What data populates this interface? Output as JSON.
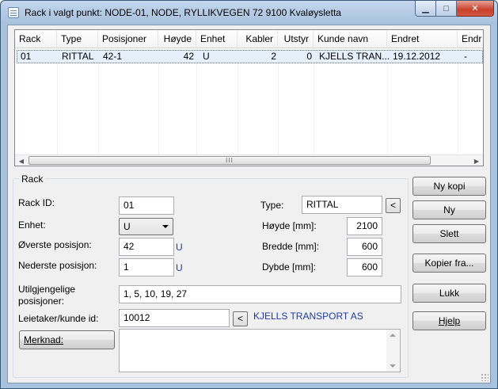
{
  "window": {
    "title": "Rack i valgt punkt: NODE-01, NODE, RYLLIKVEGEN 72 9100 Kvaløysletta",
    "minimize_glyph": "▁",
    "maximize_glyph": "□",
    "close_glyph": "✕"
  },
  "list": {
    "columns": [
      "Rack",
      "Type",
      "Posisjoner",
      "Høyde",
      "Enhet",
      "Kabler",
      "Utstyr",
      "Kunde navn",
      "Endret",
      "Endr"
    ],
    "rows": [
      [
        "01",
        "RITTAL",
        "42-1",
        "42",
        "U",
        "2",
        "0",
        "KJELLS TRAN...",
        "19.12.2012",
        "-"
      ]
    ],
    "scroll_thumb_glyph": "III",
    "left_arrow": "◀",
    "right_arrow": "▶"
  },
  "group": {
    "title": "Rack"
  },
  "form": {
    "rack_id_label": "Rack ID:",
    "rack_id_value": "01",
    "enhet_label": "Enhet:",
    "enhet_value": "U",
    "overste_label": "Øverste posisjon:",
    "overste_value": "42",
    "overste_unit": "U",
    "nederste_label": "Nederste posisjon:",
    "nederste_value": "1",
    "nederste_unit": "U",
    "type_label": "Type:",
    "type_value": "RITTAL",
    "type_btn": "<",
    "hoyde_label": "Høyde [mm]:",
    "hoyde_value": "2100",
    "bredde_label": "Bredde [mm]:",
    "bredde_value": "600",
    "dybde_label": "Dybde [mm]:",
    "dybde_value": "600",
    "utilgjengelige_label_1": "Utilgjengelige",
    "utilgjengelige_label_2": "posisjoner:",
    "utilgjengelige_value": "1, 5, 10, 19, 27",
    "leietaker_label": "Leietaker/kunde id:",
    "leietaker_value": "10012",
    "leietaker_btn": "<",
    "leietaker_name": "KJELLS TRANSPORT AS",
    "merknad_btn": "Merknad:",
    "merknad_value": ""
  },
  "buttons": {
    "ny_kopi": "Ny kopi",
    "ny": "Ny",
    "slett": "Slett",
    "kopier_fra": "Kopier fra...",
    "lukk": "Lukk",
    "hjelp": "Hjelp"
  }
}
